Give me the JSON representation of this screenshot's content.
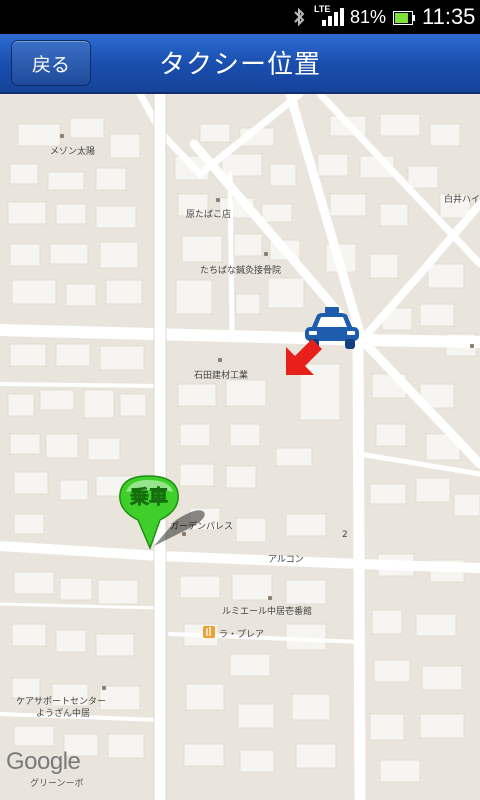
{
  "status_bar": {
    "network": "LTE",
    "battery_percent": "81%",
    "battery_level": 0.81,
    "time": "11:35",
    "icons": [
      "bluetooth-icon",
      "signal-icon",
      "battery-icon"
    ]
  },
  "header": {
    "back_label": "戻る",
    "title": "タクシー位置"
  },
  "map": {
    "places": [
      {
        "name": "maison-taiyo",
        "label": "メゾン太陽"
      },
      {
        "name": "hara-tobacco",
        "label": "原たばこ店"
      },
      {
        "name": "tachibana-clinic",
        "label": "たちばな鍼灸接骨院"
      },
      {
        "name": "shirai",
        "label": "白井ハイ"
      },
      {
        "name": "ishida-kenzai",
        "label": "石田建材工業"
      },
      {
        "name": "garden-palace",
        "label": "ガーデンパレス"
      },
      {
        "name": "arcon",
        "label": "アルコン"
      },
      {
        "name": "lumiere",
        "label": "ルミエール中居壱番館"
      },
      {
        "name": "la-prea",
        "label": "ラ・プレア"
      },
      {
        "name": "care-center",
        "label": "ケアサポートセンター"
      },
      {
        "name": "youzan",
        "label": "ようざん中居"
      }
    ],
    "pickup_label": "乗車",
    "google_logo": "Google",
    "copyright": "グリーンーボ",
    "address_number": "2",
    "colors": {
      "land": "#e9e5dc",
      "road": "#ffffff",
      "building": "#f7f5f1",
      "pin_green": "#3fcf2a",
      "taxi_blue": "#1e5cad",
      "arrow_red": "#e8201b",
      "header_blue": "#1a4faf"
    }
  }
}
